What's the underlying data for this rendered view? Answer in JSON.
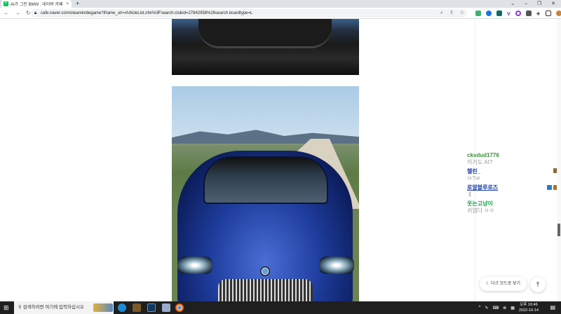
{
  "browser": {
    "tab_title": "AI가 그린 BMW : 네이버 카페",
    "url": "cafe.naver.com/steamindiegame?iframe_url=/ArticleList.nhn%3Fsearch.clubid=27842958%26search.boardtype=L"
  },
  "comments": [
    {
      "name": "cksdud1776",
      "message": "이거도 AI?",
      "color": "#3c8c3c"
    },
    {
      "name": "헬린_",
      "message": "ㅁ?ㄹ",
      "color": "#1a3ea6"
    },
    {
      "name": "로얄블루로즈",
      "message": "ㅔ",
      "color": "#1a3ea6"
    },
    {
      "name": "웃는고냥이",
      "message": "귀엽다 ㅇㅇ",
      "color": "#1aa34a"
    }
  ],
  "buttons": {
    "dark_mode": "다크 모드로 보기",
    "scroll_top": "⤒"
  },
  "taskbar": {
    "search_placeholder": "검색하려면 여기에 입력하십시오",
    "time": "오후 10:46",
    "date": "2022-10-14"
  }
}
